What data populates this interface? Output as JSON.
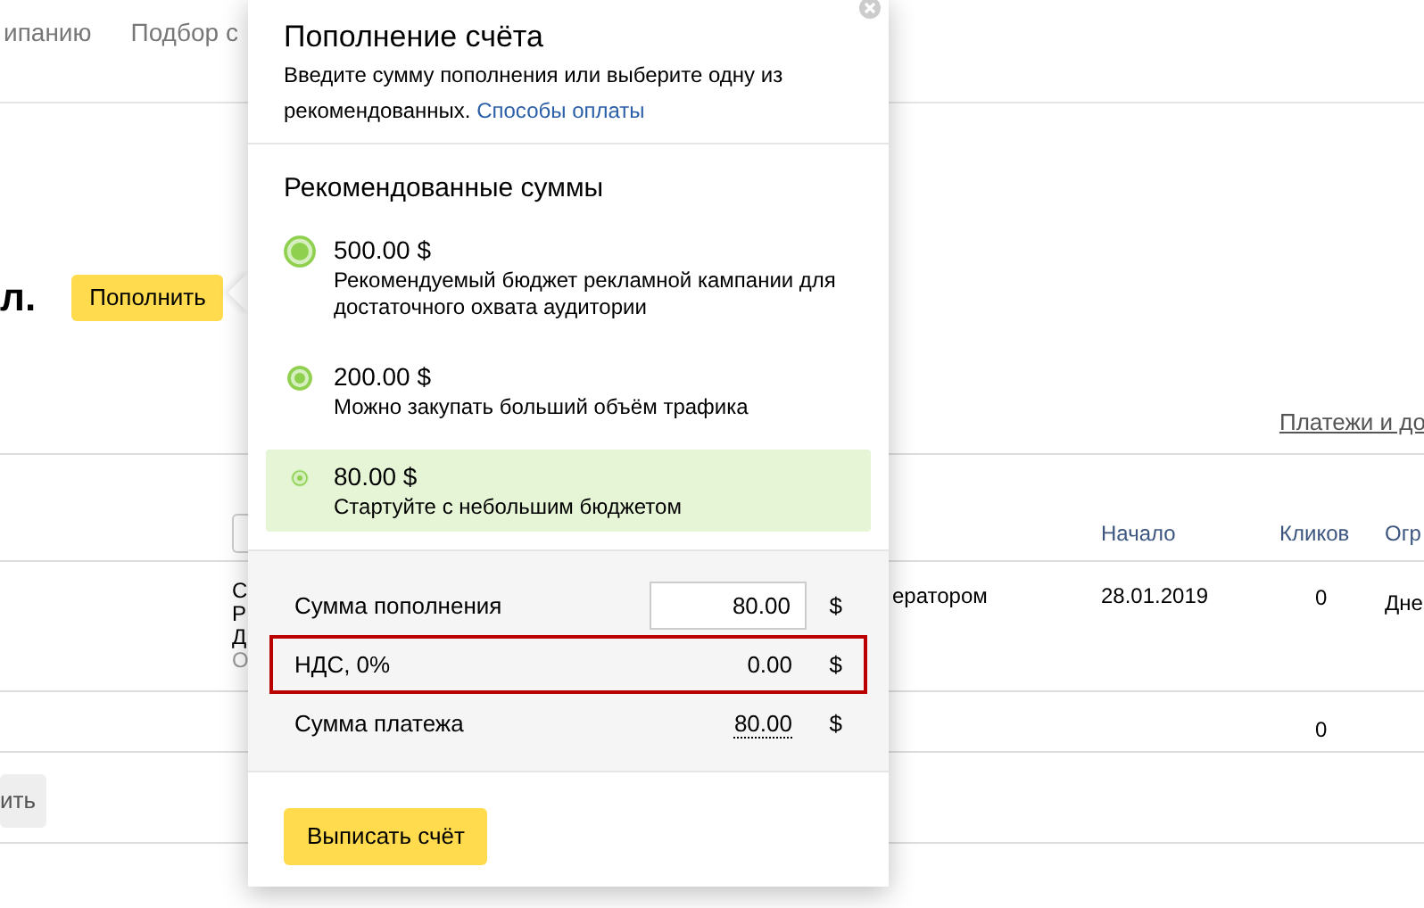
{
  "top_nav": [
    {
      "label": "ипанию"
    },
    {
      "label": "Подбор с"
    }
  ],
  "account": {
    "heading": "л.",
    "topup_button": "Пополнить"
  },
  "payments_link": "Платежи и до",
  "table": {
    "columns": [
      "Начало",
      "Кликов",
      "Огр"
    ],
    "rows": [
      {
        "column_2": [
          "С",
          "Р",
          "Д",
          "О"
        ],
        "column_3": "ератором",
        "start": "28.01.2019",
        "clicks": "0",
        "column_6": "Дне"
      },
      {
        "clicks": "0"
      }
    ]
  },
  "bottom_button": "ить",
  "popup": {
    "title": "Пополнение счёта",
    "description": "Введите сумму пополнения или выберите одну из рекомендованных.",
    "payment_methods_link": "Способы оплаты",
    "recommended_title": "Рекомендованные суммы",
    "options": [
      {
        "kind": "large",
        "amount": "500.00 $",
        "description": "Рекомендуемый бюджет рекламной кампании для достаточного охвата аудитории",
        "selected": false
      },
      {
        "kind": "medium",
        "amount": "200.00 $",
        "description": "Можно закупать больший объём трафика",
        "selected": false
      },
      {
        "kind": "small",
        "amount": "80.00 $",
        "description": "Стартуйте с небольшим бюджетом",
        "selected": true
      }
    ],
    "summary": [
      {
        "kind": "input",
        "label": "Сумма пополнения",
        "value": "80.00",
        "currency": "$",
        "highlighted": false
      },
      {
        "kind": "text",
        "label": "НДС, 0%",
        "value": "0.00",
        "currency": "$",
        "highlighted": true
      },
      {
        "kind": "dotted",
        "label": "Сумма платежа",
        "value": "80.00",
        "currency": "$",
        "highlighted": false
      }
    ],
    "submit_button": "Выписать счёт"
  }
}
